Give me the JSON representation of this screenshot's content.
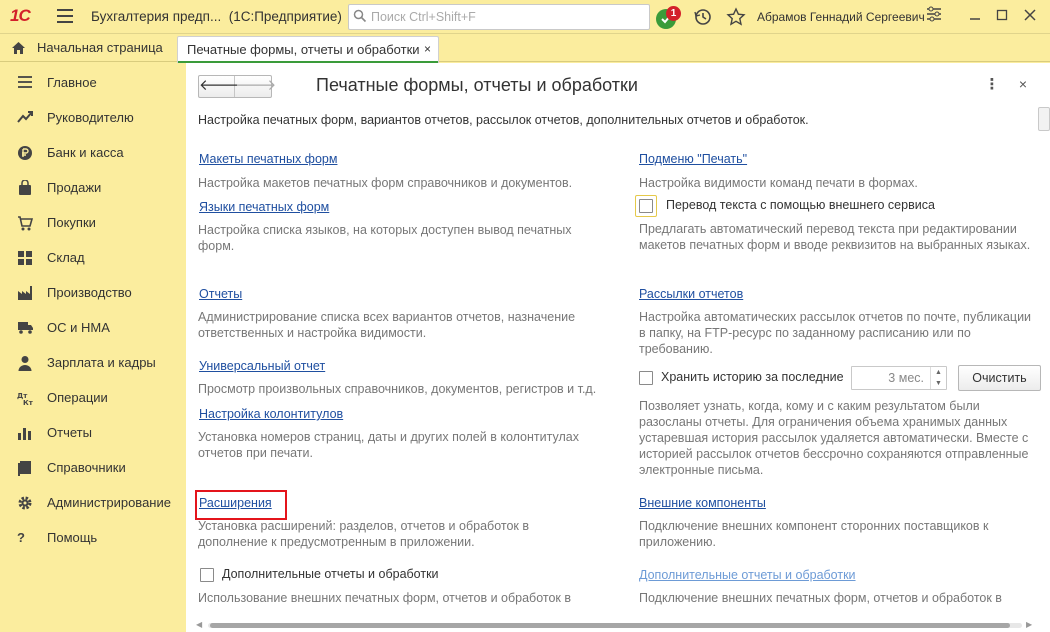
{
  "app": {
    "logo": "1С",
    "title": "Бухгалтерия предп...",
    "platform": "(1С:Предприятие)",
    "search_placeholder": "Поиск Ctrl+Shift+F",
    "notification_count": "1",
    "user": "Абрамов Геннадий Сергеевич"
  },
  "tabs": {
    "home": "Начальная страница",
    "active": "Печатные формы, отчеты и обработки",
    "close": "×"
  },
  "sidebar": {
    "items": [
      {
        "label": "Главное",
        "icon": "menu-icon"
      },
      {
        "label": "Руководителю",
        "icon": "trend-icon"
      },
      {
        "label": "Банк и касса",
        "icon": "ruble-icon"
      },
      {
        "label": "Продажи",
        "icon": "bag-icon"
      },
      {
        "label": "Покупки",
        "icon": "cart-icon"
      },
      {
        "label": "Склад",
        "icon": "warehouse-icon"
      },
      {
        "label": "Производство",
        "icon": "factory-icon"
      },
      {
        "label": "ОС и НМА",
        "icon": "truck-icon"
      },
      {
        "label": "Зарплата и кадры",
        "icon": "person-icon"
      },
      {
        "label": "Операции",
        "icon": "dt-kt-icon"
      },
      {
        "label": "Отчеты",
        "icon": "bar-chart-icon"
      },
      {
        "label": "Справочники",
        "icon": "book-icon"
      },
      {
        "label": "Администрирование",
        "icon": "gear-icon"
      },
      {
        "label": "Помощь",
        "icon": "question-icon"
      }
    ]
  },
  "form": {
    "title": "Печатные формы, отчеты и обработки",
    "intro": "Настройка печатных форм, вариантов отчетов, рассылок отчетов, дополнительных отчетов и обработок.",
    "back": "🡐",
    "forward": "🡒",
    "more": "⋮",
    "close": "×"
  },
  "left": {
    "layouts_link": "Макеты печатных форм",
    "layouts_desc": "Настройка макетов печатных форм справочников и документов.",
    "languages_link": "Языки печатных форм",
    "languages_desc": "Настройка списка языков, на которых доступен вывод печатных форм.",
    "reports_link": "Отчеты",
    "reports_desc": "Администрирование списка всех вариантов отчетов, назначение ответственных и настройка видимости.",
    "universal_link": "Универсальный отчет",
    "universal_desc": "Просмотр произвольных справочников, документов, регистров и т.д.",
    "headers_link": "Настройка колонтитулов",
    "headers_desc": "Установка номеров страниц, даты и других полей в колонтитулах отчетов при печати.",
    "extensions_link": "Расширения",
    "extensions_desc": "Установка расширений: разделов, отчетов и обработок в дополнение к предусмотренным в приложении.",
    "addl_checkbox": "Дополнительные отчеты и обработки",
    "addl_desc": "Использование внешних печатных форм, отчетов и обработок в"
  },
  "right": {
    "submenu_link": "Подменю \"Печать\"",
    "submenu_desc": "Настройка видимости команд печати в формах.",
    "translate_checkbox": "Перевод текста с помощью внешнего сервиса",
    "translate_desc": "Предлагать автоматический перевод текста при редактировании макетов печатных форм и вводе реквизитов на выбранных языках.",
    "mailing_link": "Рассылки отчетов",
    "mailing_desc": "Настройка автоматических рассылок отчетов по почте, публикации в папку, на FTP-ресурс по заданному расписанию или по требованию.",
    "history_checkbox": "Хранить историю за последние",
    "history_value": "3 мес.",
    "clear_button": "Очистить",
    "history_desc": "Позволяет узнать, когда, кому и с каким результатом были разосланы отчеты. Для ограничения объема хранимых данных устаревшая история рассылок удаляется автоматически. Вместе с историей рассылок отчетов бессрочно сохраняются отправленные электронные письма.",
    "components_link": "Внешние компоненты",
    "components_desc": "Подключение внешних компонент сторонних поставщиков к приложению.",
    "addl_link": "Дополнительные отчеты и обработки",
    "addl_desc": "Подключение внешних печатных форм, отчетов и обработок в"
  },
  "colors": {
    "panel": "#fbed9e",
    "link": "#1f4fa0",
    "highlight": "#e4141b",
    "accent": "#3a9b3a"
  }
}
